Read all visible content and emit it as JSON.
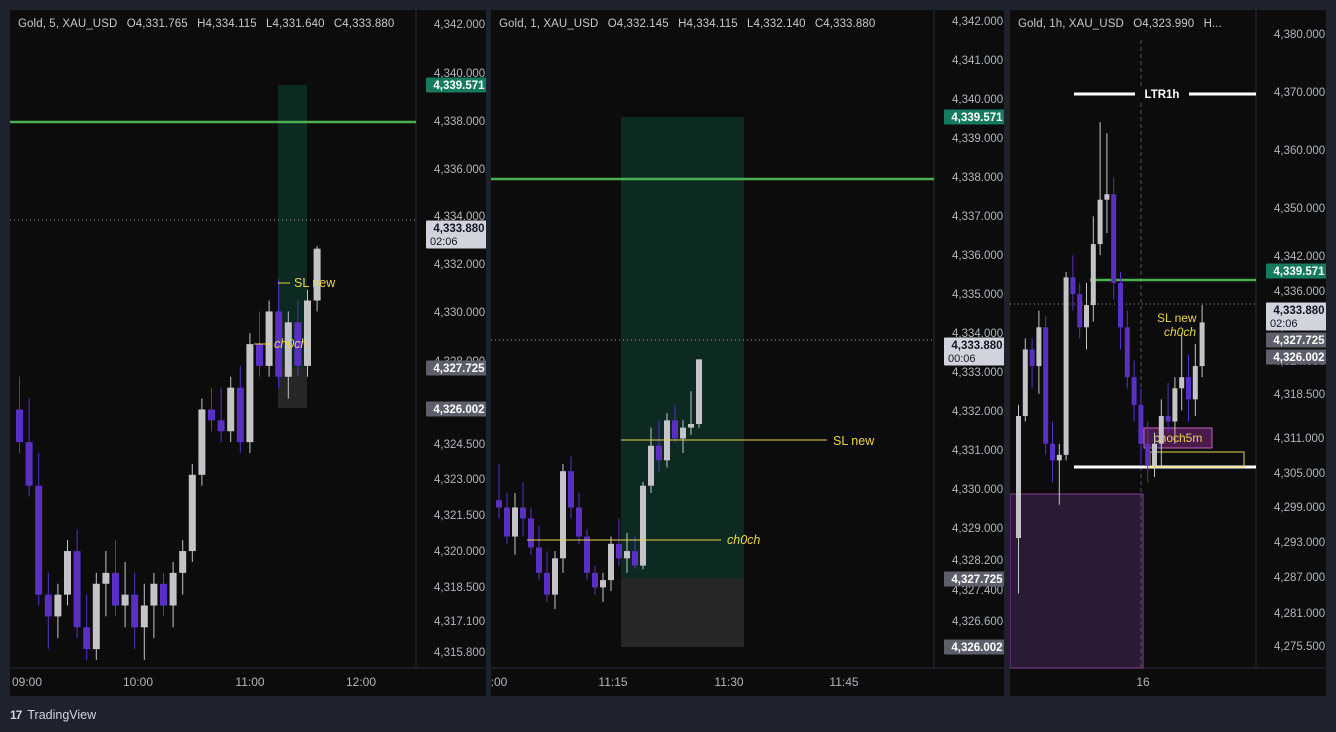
{
  "colors": {
    "bull": "#c4c4c8",
    "bear": "#5a2fc4",
    "tp_line": "#4caf50",
    "tp_label": "#157a5e",
    "grey_label": "#5d606b",
    "sl_line": "#e8d44d",
    "zone_green": "#0d2a22",
    "zone_grey": "#262626",
    "zone_purple": "#2a1a34"
  },
  "footer": {
    "brand": "TradingView",
    "logo": "17"
  },
  "panels": [
    {
      "ohlc": {
        "symbol": "Gold, 5, XAU_USD",
        "o": "O4,331.765",
        "h": "H4,334.115",
        "l": "L4,331.640",
        "c": "C4,333.880"
      },
      "y_ticks": [
        "4,342.000",
        "4,340.000",
        "4,338.000",
        "4,336.000",
        "4,334.000",
        "4,332.000",
        "4,330.000",
        "4,328.000",
        "4,326.000",
        "4,324.500",
        "4,323.000",
        "4,321.500",
        "4,320.000",
        "4,318.500",
        "4,317.100",
        "4,315.800"
      ],
      "x_ticks": [
        "09:00",
        "10:00",
        "11:00",
        "12:00"
      ],
      "price_labels": {
        "tp": "4,339.571",
        "current": "4,333.880",
        "countdown": "02:06",
        "entry": "4,327.725",
        "stop": "4,326.002"
      },
      "annotations": {
        "sl": "SL new",
        "choch": "ch0ch"
      }
    },
    {
      "ohlc": {
        "symbol": "Gold, 1, XAU_USD",
        "o": "O4,332.145",
        "h": "H4,334.115",
        "l": "L4,332.140",
        "c": "C4,333.880"
      },
      "y_ticks": [
        "4,342.000",
        "4,341.000",
        "4,340.000",
        "4,339.000",
        "4,338.000",
        "4,337.000",
        "4,336.000",
        "4,335.000",
        "4,334.000",
        "4,333.000",
        "4,332.000",
        "4,331.000",
        "4,330.000",
        "4,329.000",
        "4,328.200",
        "4,327.400",
        "4,326.600",
        "4,325.800"
      ],
      "x_ticks": [
        ":00",
        "11:15",
        "11:30",
        "11:45"
      ],
      "price_labels": {
        "tp": "4,339.571",
        "current": "4,333.880",
        "countdown": "00:06",
        "entry": "4,327.725",
        "stop": "4,326.002"
      },
      "annotations": {
        "sl": "SL new",
        "choch": "ch0ch"
      }
    },
    {
      "ohlc": {
        "symbol": "Gold, 1h, XAU_USD",
        "o": "O4,323.990",
        "h": "H..."
      },
      "y_ticks": [
        "4,380.000",
        "4,370.000",
        "4,360.000",
        "4,350.000",
        "4,342.000",
        "4,336.000",
        "4,330.000",
        "4,324.000",
        "4,318.500",
        "4,311.000",
        "4,305.000",
        "4,299.000",
        "4,293.000",
        "4,287.000",
        "4,281.000",
        "4,275.500"
      ],
      "x_ticks": [
        "16"
      ],
      "price_labels": {
        "tp": "4,339.571",
        "current": "4,333.880",
        "countdown": "02:06",
        "entry": "4,327.725",
        "stop": "4,326.002"
      },
      "annotations": {
        "ltr": "LTR1h",
        "sl": "SL new",
        "choch": "ch0ch",
        "choch5m": "choch5m"
      }
    }
  ],
  "chart_data": [
    {
      "type": "candlestick",
      "title": "Gold, 5, XAU_USD",
      "ylim": [
        4315.0,
        4343.0
      ],
      "candles": [
        [
          4326.5,
          4328.0,
          4324.5,
          4325.0
        ],
        [
          4325.0,
          4327.0,
          4322.5,
          4323.0
        ],
        [
          4323.0,
          4324.5,
          4317.5,
          4318.0
        ],
        [
          4318.0,
          4319.0,
          4315.5,
          4317.0
        ],
        [
          4317.0,
          4318.5,
          4316.0,
          4318.0
        ],
        [
          4318.0,
          4320.5,
          4317.5,
          4320.0
        ],
        [
          4320.0,
          4321.0,
          4316.0,
          4316.5
        ],
        [
          4316.5,
          4318.0,
          4315.0,
          4315.5
        ],
        [
          4315.5,
          4319.0,
          4315.0,
          4318.5
        ],
        [
          4318.5,
          4320.0,
          4317.0,
          4319.0
        ],
        [
          4319.0,
          4320.5,
          4317.0,
          4317.5
        ],
        [
          4317.5,
          4319.5,
          4316.5,
          4318.0
        ],
        [
          4318.0,
          4319.0,
          4315.5,
          4316.5
        ],
        [
          4316.5,
          4318.5,
          4315.0,
          4317.5
        ],
        [
          4317.5,
          4319.0,
          4316.0,
          4318.5
        ],
        [
          4318.5,
          4319.0,
          4317.0,
          4317.5
        ],
        [
          4317.5,
          4319.5,
          4316.5,
          4319.0
        ],
        [
          4319.0,
          4320.5,
          4318.0,
          4320.0
        ],
        [
          4320.0,
          4324.0,
          4319.5,
          4323.5
        ],
        [
          4323.5,
          4327.0,
          4323.0,
          4326.5
        ],
        [
          4326.5,
          4327.5,
          4325.5,
          4326.0
        ],
        [
          4326.0,
          4327.5,
          4325.0,
          4325.5
        ],
        [
          4325.5,
          4328.0,
          4325.0,
          4327.5
        ],
        [
          4327.5,
          4328.5,
          4324.5,
          4325.0
        ],
        [
          4325.0,
          4330.0,
          4324.5,
          4329.5
        ],
        [
          4329.5,
          4331.0,
          4328.0,
          4328.5
        ],
        [
          4328.5,
          4331.5,
          4328.0,
          4331.0
        ],
        [
          4331.0,
          4332.5,
          4327.5,
          4328.0
        ],
        [
          4328.0,
          4331.0,
          4327.0,
          4330.5
        ],
        [
          4330.5,
          4331.5,
          4328.0,
          4328.5
        ],
        [
          4328.5,
          4332.0,
          4328.0,
          4331.5
        ],
        [
          4331.5,
          4334.0,
          4331.0,
          4333.88
        ]
      ]
    },
    {
      "type": "candlestick",
      "title": "Gold, 1, XAU_USD",
      "ylim": [
        4325.6,
        4342.4
      ],
      "candles": [
        [
          4330.0,
          4331.0,
          4329.5,
          4329.8
        ],
        [
          4329.8,
          4330.2,
          4328.8,
          4329.0
        ],
        [
          4329.0,
          4330.2,
          4328.5,
          4329.8
        ],
        [
          4329.8,
          4330.5,
          4329.0,
          4329.5
        ],
        [
          4329.5,
          4329.8,
          4328.5,
          4328.7
        ],
        [
          4328.7,
          4329.3,
          4327.8,
          4328.0
        ],
        [
          4328.0,
          4328.6,
          4327.2,
          4327.4
        ],
        [
          4327.4,
          4328.6,
          4327.0,
          4328.4
        ],
        [
          4328.4,
          4331.0,
          4328.0,
          4330.8
        ],
        [
          4330.8,
          4331.2,
          4329.5,
          4329.8
        ],
        [
          4329.8,
          4330.2,
          4328.8,
          4329.0
        ],
        [
          4329.0,
          4329.2,
          4327.8,
          4328.0
        ],
        [
          4328.0,
          4328.2,
          4327.4,
          4327.6
        ],
        [
          4327.6,
          4328.0,
          4327.2,
          4327.8
        ],
        [
          4327.8,
          4329.0,
          4327.5,
          4328.8
        ],
        [
          4328.8,
          4329.5,
          4328.2,
          4328.4
        ],
        [
          4328.4,
          4329.1,
          4328.0,
          4328.6
        ],
        [
          4328.6,
          4329.0,
          4328.1,
          4328.2
        ],
        [
          4328.2,
          4330.5,
          4328.1,
          4330.4
        ],
        [
          4330.4,
          4332.0,
          4330.2,
          4331.5
        ],
        [
          4331.5,
          4332.2,
          4330.8,
          4331.1
        ],
        [
          4331.1,
          4332.4,
          4330.9,
          4332.2
        ],
        [
          4332.2,
          4332.6,
          4331.6,
          4331.7
        ],
        [
          4331.7,
          4332.2,
          4331.3,
          4332.0
        ],
        [
          4332.0,
          4333.0,
          4331.8,
          4332.1
        ],
        [
          4332.1,
          4333.88,
          4332.0,
          4333.88
        ]
      ]
    },
    {
      "type": "candlestick",
      "title": "Gold, 1h, XAU_USD",
      "ylim": [
        4273.0,
        4383.0
      ],
      "candles": [
        [
          4295.0,
          4319.0,
          4285.0,
          4317.0
        ],
        [
          4317.0,
          4331.0,
          4316.0,
          4329.0
        ],
        [
          4329.0,
          4331.0,
          4322.0,
          4326.0
        ],
        [
          4326.0,
          4336.0,
          4321.0,
          4333.0
        ],
        [
          4333.0,
          4335.0,
          4310.0,
          4312.0
        ],
        [
          4312.0,
          4316.0,
          4305.0,
          4309.0
        ],
        [
          4309.0,
          4312.0,
          4301.0,
          4310.0
        ],
        [
          4310.0,
          4343.0,
          4309.0,
          4342.0
        ],
        [
          4342.0,
          4346.0,
          4336.0,
          4339.0
        ],
        [
          4339.0,
          4341.0,
          4331.0,
          4333.0
        ],
        [
          4333.0,
          4341.0,
          4329.0,
          4337.0
        ],
        [
          4337.0,
          4353.0,
          4334.0,
          4348.0
        ],
        [
          4348.0,
          4370.0,
          4346.0,
          4356.0
        ],
        [
          4356.0,
          4368.0,
          4350.0,
          4357.0
        ],
        [
          4357.0,
          4360.0,
          4338.0,
          4341.0
        ],
        [
          4341.0,
          4343.0,
          4329.0,
          4333.0
        ],
        [
          4333.0,
          4336.0,
          4322.0,
          4324.0
        ],
        [
          4324.0,
          4327.0,
          4316.0,
          4319.0
        ],
        [
          4319.0,
          4322.0,
          4308.0,
          4312.0
        ],
        [
          4312.0,
          4316.0,
          4305.0,
          4308.0
        ],
        [
          4308.0,
          4314.0,
          4306.0,
          4312.0
        ],
        [
          4312.0,
          4320.0,
          4308.0,
          4317.0
        ],
        [
          4317.0,
          4323.0,
          4314.0,
          4316.0
        ],
        [
          4316.0,
          4324.0,
          4312.0,
          4322.0
        ],
        [
          4322.0,
          4332.0,
          4318.0,
          4324.0
        ],
        [
          4324.0,
          4328.0,
          4316.0,
          4320.0
        ],
        [
          4320.0,
          4330.0,
          4317.0,
          4326.0
        ],
        [
          4326.0,
          4337.0,
          4324.0,
          4333.88
        ]
      ]
    }
  ]
}
